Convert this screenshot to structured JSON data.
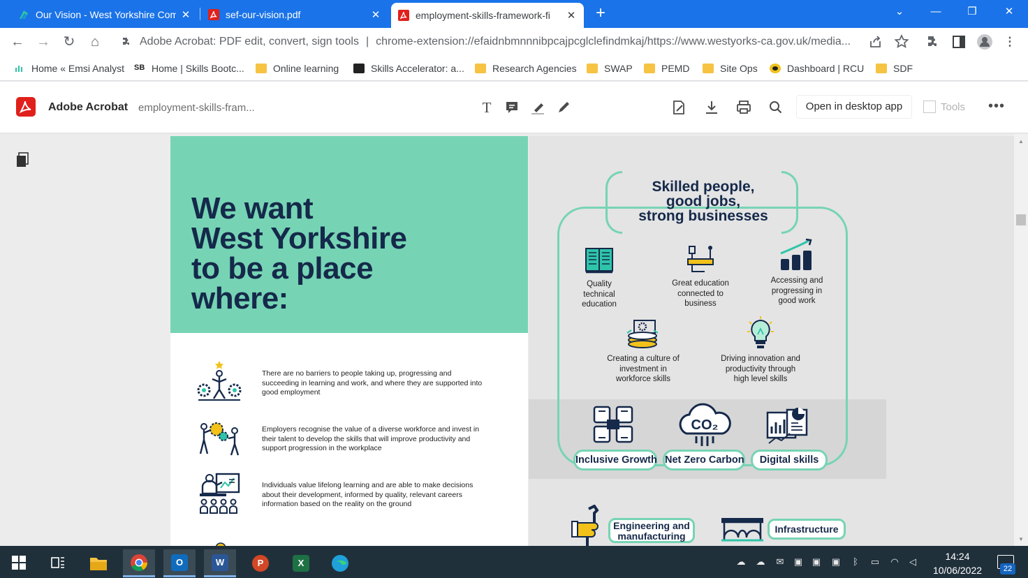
{
  "browser": {
    "tabs": [
      {
        "title": "Our Vision - West Yorkshire Com",
        "close": "✕"
      },
      {
        "title": "sef-our-vision.pdf",
        "close": "✕"
      },
      {
        "title": "employment-skills-framework-fi",
        "close": "✕"
      }
    ],
    "new_tab": "+",
    "window": {
      "dropdown": "⌄",
      "minimize": "—",
      "restore": "❐",
      "close": "✕"
    },
    "nav": {
      "back": "←",
      "forward": "→",
      "reload": "↻",
      "home": "⌂"
    },
    "address": {
      "site": "Adobe Acrobat: PDF edit, convert, sign tools",
      "separator": "|",
      "url": "chrome-extension://efaidnbmnnnibpcajpcglclefindmkaj/https://www.westyorks-ca.gov.uk/media..."
    },
    "bookmarks": [
      "Home « Emsi Analyst",
      "Home | Skills Bootc...",
      "Online learning",
      "Skills Accelerator: a...",
      "Research Agencies",
      "SWAP",
      "PEMD",
      "Site Ops",
      "Dashboard | RCU",
      "SDF"
    ]
  },
  "acrobat": {
    "app_name": "Adobe Acrobat",
    "file_name": "employment-skills-fram...",
    "open_desktop": "Open in desktop app",
    "tools": "Tools",
    "more": "•••"
  },
  "document": {
    "hero_title": [
      "We want",
      "West Yorkshire",
      "to be a place",
      "where:"
    ],
    "statements": [
      "There are no barriers to people taking up, progressing and succeeding in learning and work, and where they are supported into good employment",
      "Employers recognise the value of a diverse workforce and invest in their talent to develop the skills that will improve productivity and support progression in the workplace",
      "Individuals value lifelong learning and are able to make decisions about their development, informed by quality, relevant careers information based on the reality on the ground"
    ],
    "vision_headline": [
      "Skilled people,",
      "good jobs,",
      "strong businesses"
    ],
    "vision_items": [
      {
        "label": [
          "Quality",
          "technical",
          "education"
        ],
        "icon": "book-icon"
      },
      {
        "label": [
          "Great education",
          "connected to",
          "business"
        ],
        "icon": "pencil-network-icon"
      },
      {
        "label": [
          "Accessing and",
          "progressing in",
          "good work"
        ],
        "icon": "growth-bars-icon"
      },
      {
        "label": [
          "Creating a culture of",
          "investment in",
          "workforce skills"
        ],
        "icon": "coins-gear-icon"
      },
      {
        "label": [
          "Driving innovation and",
          "productivity through",
          "high level skills"
        ],
        "icon": "lightbulb-icon"
      }
    ],
    "themes": [
      "Inclusive Growth",
      "Net Zero Carbon",
      "Digital skills"
    ],
    "co2": "CO₂",
    "sectors": [
      {
        "label": [
          "Engineering and",
          "manufacturing"
        ]
      },
      {
        "label": [
          "Infrastructure"
        ]
      }
    ]
  },
  "taskbar": {
    "time": "14:24",
    "date": "10/06/2022",
    "notifications": "22",
    "apps": [
      {
        "name": "outlook",
        "letter": "O",
        "color": "#0f6cbd"
      },
      {
        "name": "word",
        "letter": "W",
        "color": "#2b5797"
      },
      {
        "name": "powerpoint",
        "letter": "P",
        "color": "#d24726"
      },
      {
        "name": "excel",
        "letter": "X",
        "color": "#1e7145"
      }
    ]
  },
  "colors": {
    "chrome_blue": "#1a73e8",
    "mint": "#76d4b4",
    "navy": "#15294a",
    "acrobat_red": "#e0201b"
  }
}
